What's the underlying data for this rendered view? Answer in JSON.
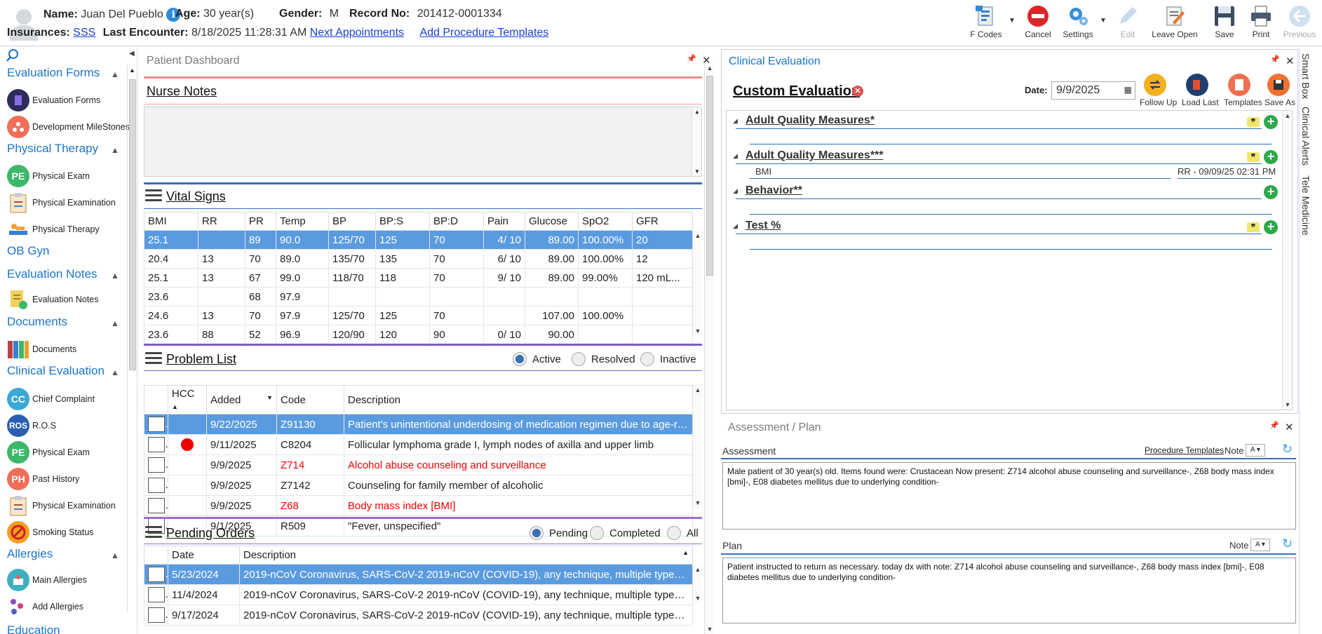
{
  "patient": {
    "name_label": "Name:",
    "name": "Juan Del Pueblo",
    "age_label": "Age:",
    "age": "30 year(s)",
    "gender_label": "Gender:",
    "gender": "M",
    "record_label": "Record No:",
    "record": "201412-0001334",
    "ins_label": "Insurances:",
    "insurance": "SSS",
    "last_enc_label": "Last Encounter:",
    "last_encounter": "8/18/2025 11:28:31 AM",
    "next_appts": "Next Appointments",
    "add_proc_templates": "Add Procedure Templates"
  },
  "toolbar": {
    "fcodes": "F Codes",
    "cancel": "Cancel",
    "settings": "Settings",
    "edit": "Edit",
    "leave_open": "Leave Open",
    "save": "Save",
    "print": "Print",
    "previous": "Previous"
  },
  "sidebar": {
    "sections": [
      {
        "title": "Evaluation Forms",
        "items": [
          "Evaluation Forms",
          "Development MileStones"
        ]
      },
      {
        "title": "Physical Therapy",
        "items": [
          "Physical Exam",
          "Physical Examination",
          "Physical Therapy"
        ]
      },
      {
        "title": "OB Gyn",
        "items": []
      },
      {
        "title": "Evaluation Notes",
        "items": [
          "Evaluation Notes"
        ]
      },
      {
        "title": "Documents",
        "items": [
          "Documents"
        ]
      },
      {
        "title": "Clinical Evaluation",
        "items": [
          "Chief Complaint",
          "R.O.S",
          "Physical Exam",
          "Past History",
          "Physical Examination",
          "Smoking Status"
        ]
      },
      {
        "title": "Allergies",
        "items": [
          "Main Allergies",
          "Add Allergies"
        ]
      },
      {
        "title": "Education",
        "items": []
      }
    ],
    "badges": {
      "pe": "PE",
      "cc": "CC",
      "ros": "ROS",
      "ph": "PH"
    }
  },
  "dashboard": {
    "title": "Patient Dashboard",
    "nurse_notes": "Nurse Notes",
    "vital_signs": "Vital Signs",
    "vitals_headers": [
      "BMI",
      "RR",
      "PR",
      "Temp",
      "BP",
      "BP:S",
      "BP:D",
      "Pain",
      "Glucose",
      "SpO2",
      "GFR"
    ],
    "vitals_rows": [
      [
        "25.1",
        "",
        "89",
        "90.0",
        "125/70",
        "125",
        "70",
        "4/ 10",
        "89.00",
        "100.00%",
        "20"
      ],
      [
        "20.4",
        "13",
        "70",
        "89.0",
        "135/70",
        "135",
        "70",
        "6/ 10",
        "89.00",
        "100.00%",
        "12"
      ],
      [
        "25.1",
        "13",
        "67",
        "99.0",
        "118/70",
        "118",
        "70",
        "9/ 10",
        "89.00",
        "99.00%",
        "120 mL..."
      ],
      [
        "23.6",
        "",
        "68",
        "97.9",
        "",
        "",
        "",
        "",
        "",
        "",
        ""
      ],
      [
        "24.6",
        "13",
        "70",
        "97.9",
        "125/70",
        "125",
        "70",
        "",
        "107.00",
        "100.00%",
        ""
      ],
      [
        "23.6",
        "88",
        "52",
        "96.9",
        "120/90",
        "120",
        "90",
        "0/ 10",
        "90.00",
        "",
        ""
      ]
    ],
    "problem_list": "Problem List",
    "problem_filters": [
      "Active",
      "Resolved",
      "Inactive"
    ],
    "problem_headers": [
      "",
      "HCC",
      "Added",
      "Code",
      "Description"
    ],
    "problem_rows": [
      {
        "hcc": false,
        "added": "9/22/2025",
        "code": "Z91130",
        "desc": "Patient's unintentional underdosing of medication regimen due to age-related debility",
        "red": false
      },
      {
        "hcc": true,
        "added": "9/11/2025",
        "code": "C8204",
        "desc": "Follicular lymphoma grade I, lymph nodes of axilla and upper limb",
        "red": false
      },
      {
        "hcc": false,
        "added": "9/9/2025",
        "code": "Z714",
        "desc": "Alcohol abuse counseling and surveillance",
        "red": true
      },
      {
        "hcc": false,
        "added": "9/9/2025",
        "code": "Z7142",
        "desc": "Counseling for family member of alcoholic",
        "red": false
      },
      {
        "hcc": false,
        "added": "9/9/2025",
        "code": "Z68",
        "desc": "Body mass index [BMI]",
        "red": true
      },
      {
        "hcc": false,
        "added": "9/1/2025",
        "code": "R509",
        "desc": "\"Fever, unspecified\"",
        "red": false
      }
    ],
    "pending_orders": "Pending Orders",
    "order_filters": [
      "Pending",
      "Completed",
      "All"
    ],
    "order_headers": [
      "",
      "Date",
      "Description"
    ],
    "order_rows": [
      {
        "date": "5/23/2024",
        "desc": "2019-nCoV Coronavirus, SARS-CoV-2 2019-nCoV (COVID-19), any technique, multiple types or subtypes"
      },
      {
        "date": "11/4/2024",
        "desc": "2019-nCoV Coronavirus, SARS-CoV-2 2019-nCoV (COVID-19), any technique, multiple types or subtypes"
      },
      {
        "date": "9/17/2024",
        "desc": "2019-nCoV Coronavirus, SARS-CoV-2 2019-nCoV (COVID-19), any technique, multiple types or subtypes"
      }
    ]
  },
  "clinical": {
    "title": "Clinical Evaluation",
    "custom_eval": "Custom Evaluation",
    "date_label": "Date:",
    "date": "9/9/2025",
    "buttons": [
      "Follow Up",
      "Load Last",
      "Templates",
      "Save As"
    ],
    "groups": [
      {
        "title": "Adult Quality Measures*",
        "sub": "",
        "right": ""
      },
      {
        "title": "Adult Quality Measures***",
        "sub": "BMI",
        "right": "RR - 09/09/25 02:31 PM"
      },
      {
        "title": "Behavior**",
        "sub": "",
        "right": ""
      },
      {
        "title": "Test %",
        "sub": "",
        "right": ""
      }
    ]
  },
  "assessment": {
    "title": "Assessment / Plan",
    "assessment_label": "Assessment",
    "proc_templates": "Procedure Templates",
    "note_label": "Note",
    "assessment_text": "Male patient of 30 year(s) old.  Items found were:  Crustacean  Now present:  Z714 alcohol abuse counseling and surveillance-, Z68 body mass index [bmi]-, E08 diabetes mellitus due to underlying condition-",
    "plan_label": "Plan",
    "plan_text": "  Patient instructed to return as necessary.  today dx with note:  Z714 alcohol abuse counseling and surveillance-, Z68 body mass index [bmi]-, E08 diabetes mellitus due to underlying condition-"
  },
  "side_tabs": [
    "Smart Box",
    "Clinical Alerts",
    "Tele Medicine"
  ]
}
